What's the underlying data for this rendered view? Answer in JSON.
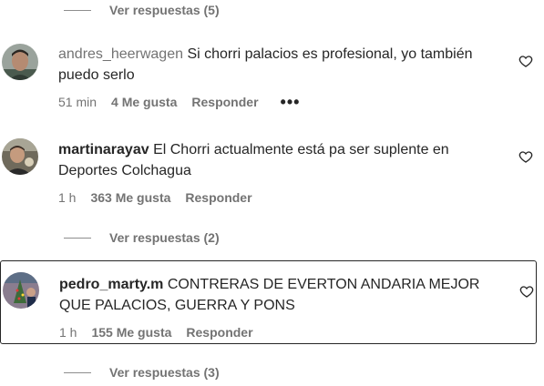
{
  "replies_top": {
    "label": "Ver respuestas (5)"
  },
  "comments": [
    {
      "username": "andres_heerwagen",
      "text": "Si chorri palacios es profesional, yo también puedo serlo",
      "time": "51 min",
      "likes": "4 Me gusta",
      "reply_label": "Responder",
      "more_label": "•••"
    },
    {
      "username": "martinarayav",
      "text": "El Chorri actualmente está pa ser suplente en Deportes Colchagua",
      "time": "1 h",
      "likes": "363 Me gusta",
      "reply_label": "Responder",
      "view_replies": "Ver respuestas (2)"
    },
    {
      "username": "pedro_marty.m",
      "text": "CONTRERAS DE EVERTON ANDARIA MEJOR QUE PALACIOS, GUERRA Y PONS",
      "time": "1 h",
      "likes": "155 Me gusta",
      "reply_label": "Responder",
      "view_replies": "Ver respuestas (3)"
    }
  ],
  "colors": {
    "text": "#262626",
    "secondary": "#737373",
    "focus_border": "#262626"
  }
}
